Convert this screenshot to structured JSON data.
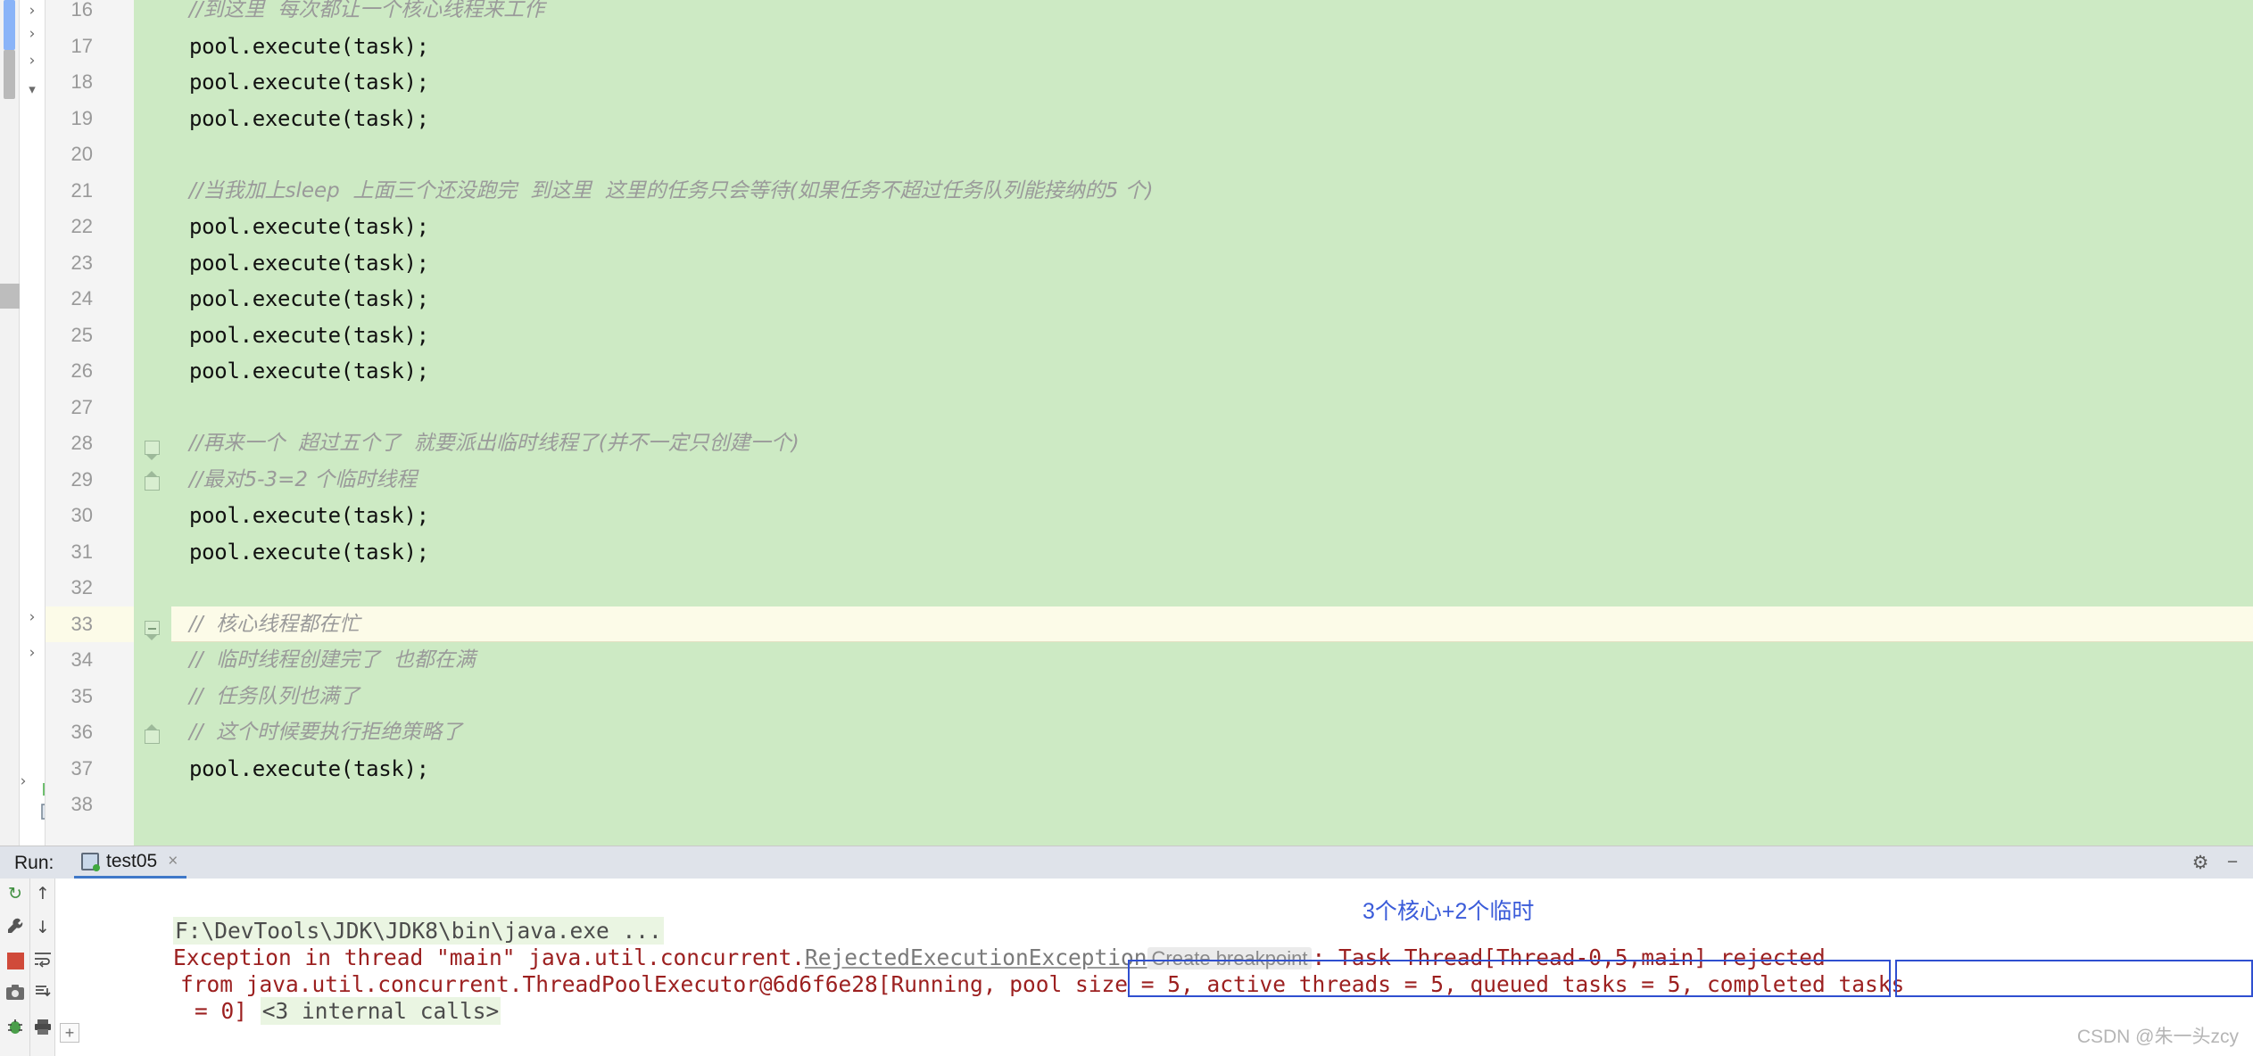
{
  "editor": {
    "background_color": "#cdeac4",
    "highlight_color": "#fcfbe8",
    "lines": [
      {
        "num": "16",
        "text": "//到这里  每次都让一个核心线程来工作",
        "kind": "comment"
      },
      {
        "num": "17",
        "text": "pool.execute(task);",
        "kind": "code"
      },
      {
        "num": "18",
        "text": "pool.execute(task);",
        "kind": "code"
      },
      {
        "num": "19",
        "text": "pool.execute(task);",
        "kind": "code"
      },
      {
        "num": "20",
        "text": "",
        "kind": "code"
      },
      {
        "num": "21",
        "text": "//当我加上sleep  上面三个还没跑完  到这里  这里的任务只会等待(如果任务不超过任务队列能接纳的5 个)",
        "kind": "comment"
      },
      {
        "num": "22",
        "text": "pool.execute(task);",
        "kind": "code"
      },
      {
        "num": "23",
        "text": "pool.execute(task);",
        "kind": "code"
      },
      {
        "num": "24",
        "text": "pool.execute(task);",
        "kind": "code"
      },
      {
        "num": "25",
        "text": "pool.execute(task);",
        "kind": "code"
      },
      {
        "num": "26",
        "text": "pool.execute(task);",
        "kind": "code"
      },
      {
        "num": "27",
        "text": "",
        "kind": "code"
      },
      {
        "num": "28",
        "text": "//再来一个  超过五个了  就要派出临时线程了(并不一定只创建一个)",
        "kind": "comment"
      },
      {
        "num": "29",
        "text": "//最对5-3=2 个临时线程",
        "kind": "comment"
      },
      {
        "num": "30",
        "text": "pool.execute(task);",
        "kind": "code"
      },
      {
        "num": "31",
        "text": "pool.execute(task);",
        "kind": "code"
      },
      {
        "num": "32",
        "text": "",
        "kind": "code"
      },
      {
        "num": "33",
        "text": "//  核心线程都在忙",
        "kind": "comment"
      },
      {
        "num": "34",
        "text": "//  临时线程创建完了  也都在满",
        "kind": "comment"
      },
      {
        "num": "35",
        "text": "//  任务队列也满了",
        "kind": "comment"
      },
      {
        "num": "36",
        "text": "//  这个时候要执行拒绝策略了",
        "kind": "comment"
      },
      {
        "num": "37",
        "text": "pool.execute(task);",
        "kind": "code"
      },
      {
        "num": "38",
        "text": "",
        "kind": "code"
      }
    ]
  },
  "run_panel": {
    "run_label": "Run:",
    "tab_name": "test05",
    "tab_close": "×",
    "gear_icon": "⚙",
    "minimize_icon": "−",
    "console": {
      "line1": "F:\\DevTools\\JDK\\JDK8\\bin\\java.exe ...",
      "line2_a": "Exception in thread \"main\" java.util.concurrent.",
      "line2_link": "RejectedExecutionException",
      "line2_hint": "Create breakpoint",
      "line2_b": ": Task Thread[Thread-0,5,main] rejected",
      "line3_a": "from java.util.concurrent.ThreadPoolExecutor@6d6f6e28[Running, ",
      "line3_b": "pool size = 5, active threads = 5, queued tasks = 5, ",
      "line3_c": "completed tasks",
      "line4_a": "= 0]",
      "line4_b": "<3 internal calls>",
      "expand_icon": "+"
    }
  },
  "annotations": {
    "callout_text": "3个核心+2个临时",
    "callout_color": "#3a5bd9",
    "box_color": "#2f4fd0"
  },
  "watermark": "CSDN @朱一头zcy",
  "icons": {
    "chevron_right": "›",
    "chevron_down": "⌄",
    "rerun": "↻",
    "up_arrow": "↑",
    "down_arrow": "↓",
    "wrench": "🔧",
    "stop": "■",
    "wrap": "↵",
    "camera": "📷",
    "scroll_end": "⇩",
    "print": "🖨",
    "bug": "🐞"
  }
}
